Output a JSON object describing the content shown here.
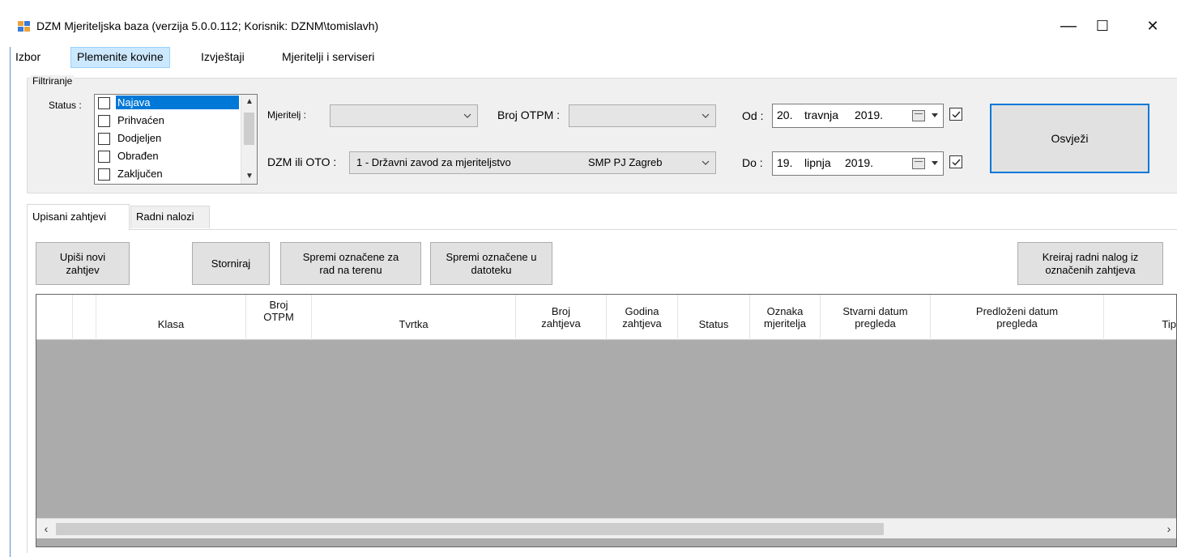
{
  "window": {
    "title": "DZM Mjeriteljska baza (verzija 5.0.0.112; Korisnik: DZNM\\tomislavh)",
    "controls": {
      "minimize": "—",
      "maximize": "☐",
      "close": "✕"
    }
  },
  "menu": {
    "items": [
      {
        "label": "Izbor",
        "active": false
      },
      {
        "label": "Plemenite kovine",
        "active": true
      },
      {
        "label": "Izvještaji",
        "active": false
      },
      {
        "label": "Mjeritelji i serviseri",
        "active": false
      }
    ]
  },
  "filter": {
    "group_label": "Filtriranje",
    "status_label": "Status :",
    "status_items": [
      {
        "label": "Najava",
        "checked": false,
        "selected": true
      },
      {
        "label": "Prihvaćen",
        "checked": false,
        "selected": false
      },
      {
        "label": "Dodjeljen",
        "checked": false,
        "selected": false
      },
      {
        "label": "Obrađen",
        "checked": false,
        "selected": false
      },
      {
        "label": "Zaključen",
        "checked": false,
        "selected": false
      }
    ],
    "mjeritelj_label": "Mjeritelj :",
    "mjeritelj_value": "",
    "broj_otpm_label": "Broj OTPM :",
    "broj_otpm_value": "",
    "dzm_oto_label": "DZM ili OTO :",
    "dzm_oto_value": "1 - Državni zavod za mjeriteljstvo",
    "dzm_oto_value2": "SMP PJ Zagreb",
    "od_label": "Od :",
    "od_date": {
      "day": "20.",
      "month": "travnja",
      "year": "2019."
    },
    "od_checked": true,
    "do_label": "Do :",
    "do_date": {
      "day": "19.",
      "month": "lipnja",
      "year": "2019."
    },
    "do_checked": true,
    "refresh_label": "Osvježi"
  },
  "tabs": [
    {
      "label": "Upisani zahtjevi",
      "active": true
    },
    {
      "label": "Radni nalozi",
      "active": false
    }
  ],
  "toolbar": {
    "new_request": "Upiši novi\nzahtjev",
    "cancel": "Storniraj",
    "save_field": "Spremi označene za\nrad na terenu",
    "save_file": "Spremi označene u\ndatoteku",
    "create_order": "Kreiraj radni nalog iz\noznačenih zahtjeva"
  },
  "grid": {
    "columns": [
      "",
      "",
      "Klasa",
      "Broj\nOTPM",
      "Tvrtka",
      "Broj\nzahtjeva",
      "Godina\nzahtjeva",
      "Status",
      "Oznaka\nmjeritelja",
      "Stvarni datum\npregleda",
      "Predloženi datum\npregleda",
      "Tip"
    ],
    "rows": []
  },
  "colors": {
    "accent": "#0078d7",
    "menu_active_bg": "#cce8ff",
    "grid_bg": "#ababab"
  }
}
